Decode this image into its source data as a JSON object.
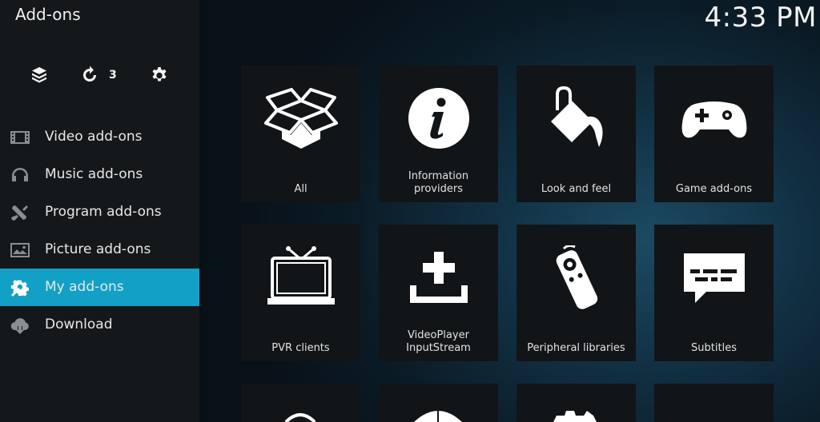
{
  "header": {
    "title": "Add-ons",
    "clock": "4:33 PM"
  },
  "toolbar": {
    "items": [
      {
        "icon": "package-box-icon"
      },
      {
        "icon": "refresh-icon",
        "count": "3"
      },
      {
        "icon": "gear-icon"
      }
    ]
  },
  "sidebar": {
    "items": [
      {
        "label": "Video add-ons",
        "icon": "film-icon",
        "active": false
      },
      {
        "label": "Music add-ons",
        "icon": "headphones-icon",
        "active": false
      },
      {
        "label": "Program add-ons",
        "icon": "tools-icon",
        "active": false
      },
      {
        "label": "Picture add-ons",
        "icon": "picture-icon",
        "active": false
      },
      {
        "label": "My add-ons",
        "icon": "settings-tools-icon",
        "active": true
      },
      {
        "label": "Download",
        "icon": "cloud-download-icon",
        "active": false
      }
    ]
  },
  "tiles": [
    {
      "line1": "",
      "line2": "All",
      "icon": "open-box-icon"
    },
    {
      "line1": "Information",
      "line2": "providers",
      "icon": "info-icon"
    },
    {
      "line1": "",
      "line2": "Look and feel",
      "icon": "paint-bucket-icon"
    },
    {
      "line1": "",
      "line2": "Game add-ons",
      "icon": "gamepad-icon"
    },
    {
      "line1": "",
      "line2": "PVR clients",
      "icon": "tv-icon"
    },
    {
      "line1": "VideoPlayer",
      "line2": "InputStream",
      "icon": "input-stream-icon"
    },
    {
      "line1": "",
      "line2": "Peripheral libraries",
      "icon": "remote-icon"
    },
    {
      "line1": "",
      "line2": "Subtitles",
      "icon": "subtitles-icon"
    }
  ]
}
